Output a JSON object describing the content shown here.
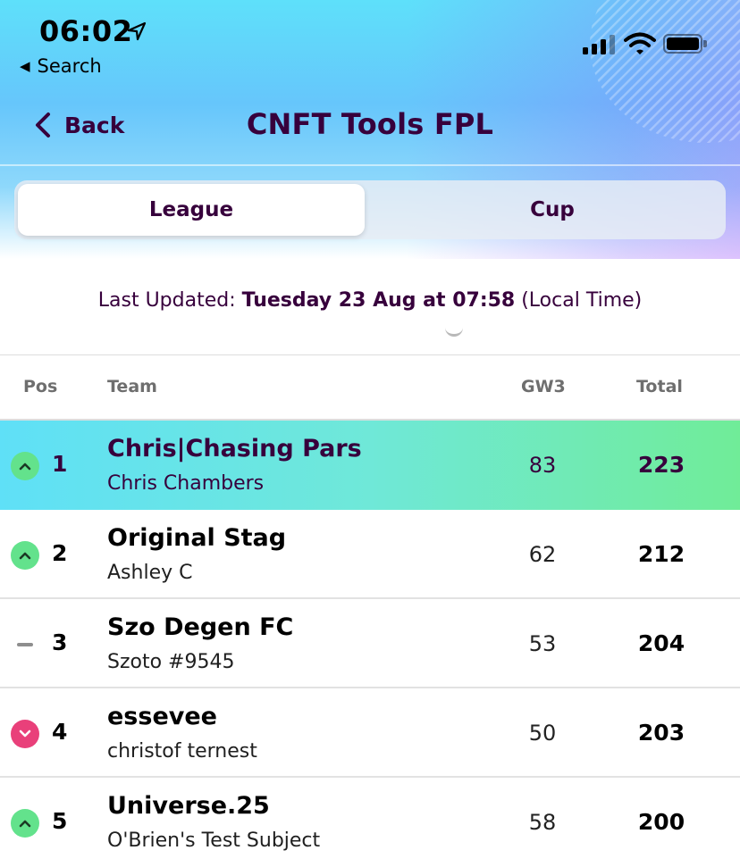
{
  "status_bar": {
    "time": "06:02",
    "back_app": "Search",
    "icons": [
      "location-arrow-icon",
      "cellular-signal-icon",
      "wifi-icon",
      "battery-icon"
    ]
  },
  "nav": {
    "back_label": "Back",
    "title": "CNFT Tools FPL"
  },
  "tabs": [
    {
      "label": "League",
      "selected": true
    },
    {
      "label": "Cup",
      "selected": false
    }
  ],
  "updated": {
    "prefix": "Last Updated: ",
    "when": "Tuesday 23 Aug at 07:58",
    "suffix": " (Local Time)"
  },
  "table": {
    "headers": {
      "pos": "Pos",
      "team": "Team",
      "gw": "GW3",
      "total": "Total"
    },
    "rows": [
      {
        "pos": "1",
        "movement": "up",
        "team": "Chris|Chasing Pars",
        "manager": "Chris Chambers",
        "gw": "83",
        "total": "223",
        "highlight": true
      },
      {
        "pos": "2",
        "movement": "up",
        "team": "Original Stag",
        "manager": "Ashley C",
        "gw": "62",
        "total": "212",
        "highlight": false
      },
      {
        "pos": "3",
        "movement": "same",
        "team": "Szo Degen FC",
        "manager": "Szoto #9545",
        "gw": "53",
        "total": "204",
        "highlight": false
      },
      {
        "pos": "4",
        "movement": "down",
        "team": "essevee",
        "manager": "christof ternest",
        "gw": "50",
        "total": "203",
        "highlight": false
      },
      {
        "pos": "5",
        "movement": "up",
        "team": "Universe.25",
        "manager": "O'Brien's Test Subject",
        "gw": "58",
        "total": "200",
        "highlight": false
      }
    ]
  },
  "colors": {
    "brand_purple": "#37003c",
    "rise_green": "#63e28c",
    "fall_pink": "#e9407a"
  }
}
